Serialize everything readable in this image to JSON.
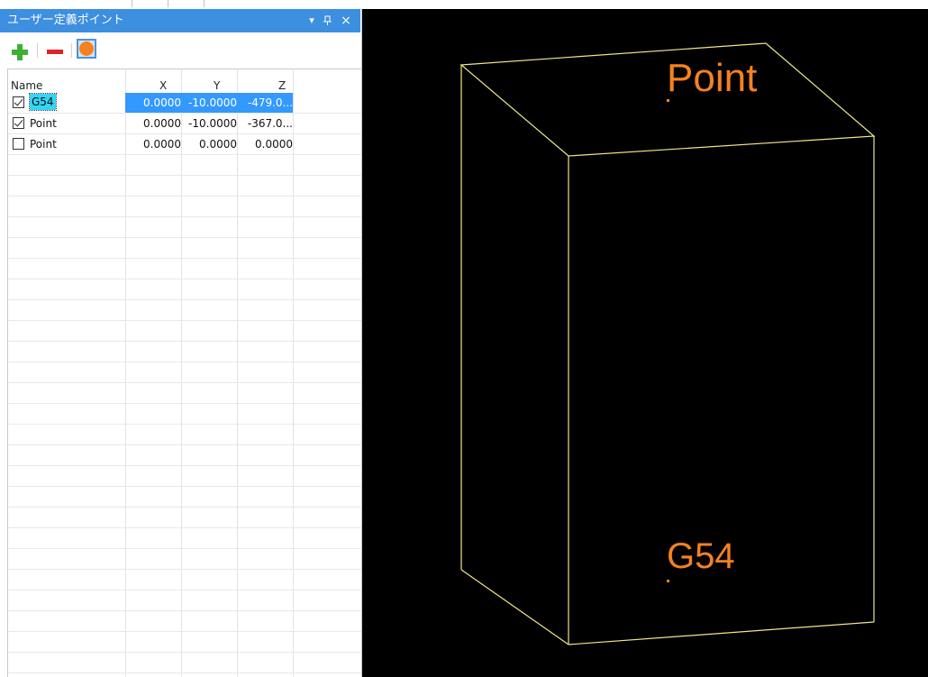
{
  "panel": {
    "title": "ユーザー定義ポイント",
    "controls": {
      "dropdown": "▾",
      "pin": "ꟷ",
      "close": "×"
    }
  },
  "toolbar": {
    "add_icon": "plus-icon",
    "remove_icon": "minus-icon",
    "point_icon": "point-icon"
  },
  "grid": {
    "columns": [
      "Name",
      "X",
      "Y",
      "Z"
    ],
    "rows": [
      {
        "checked": true,
        "name": "G54",
        "x": "0.0000",
        "y": "-10.0000",
        "z": "-479.0...",
        "selected": true
      },
      {
        "checked": true,
        "name": "Point",
        "x": "0.0000",
        "y": "-10.0000",
        "z": "-367.0...",
        "selected": false
      },
      {
        "checked": false,
        "name": "Point",
        "x": "0.0000",
        "y": "0.0000",
        "z": "0.0000",
        "selected": false
      }
    ]
  },
  "viewport": {
    "labels": {
      "top": "Point",
      "bottom": "G54"
    },
    "colors": {
      "background": "#000000",
      "box_edge": "#f0e68c",
      "label": "#f5821f"
    }
  }
}
